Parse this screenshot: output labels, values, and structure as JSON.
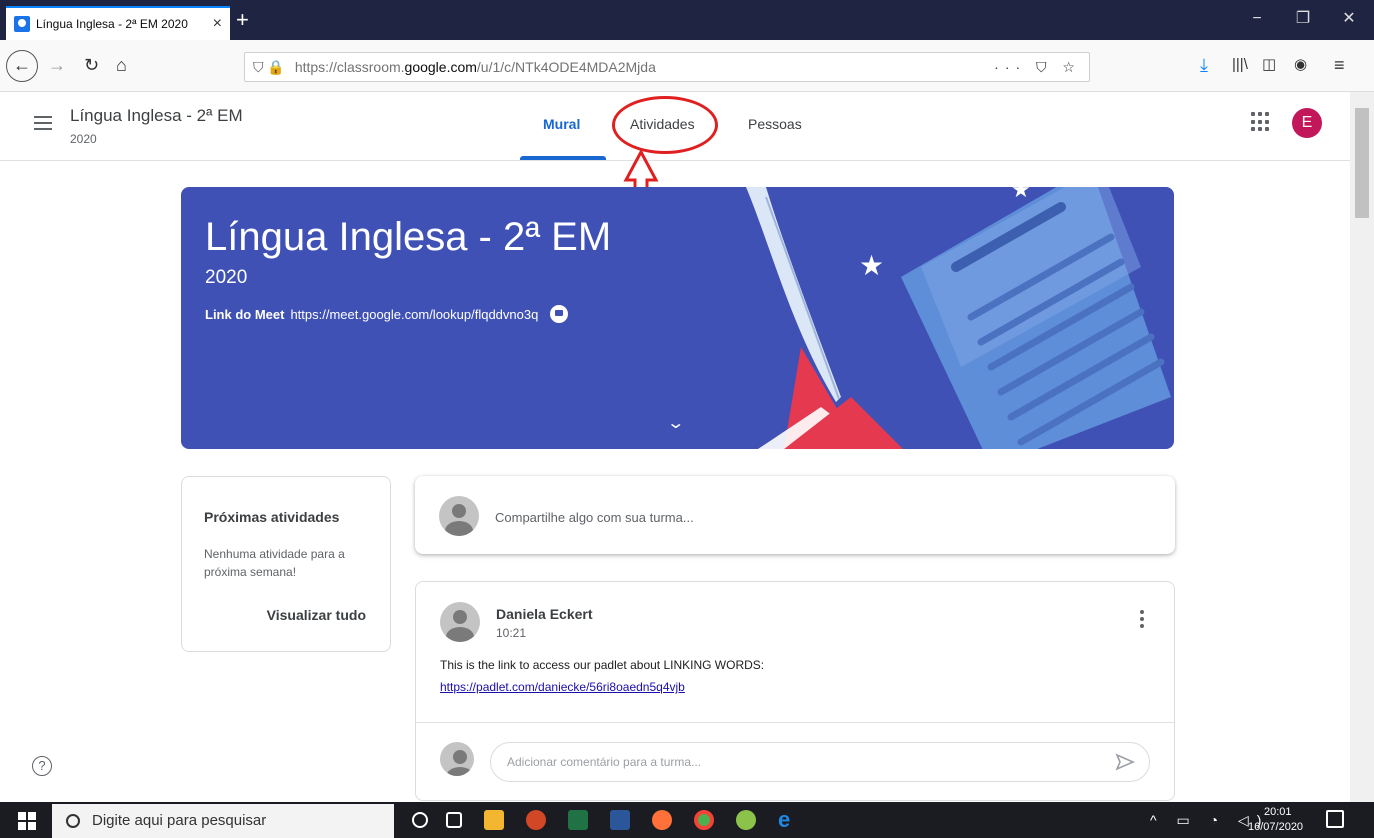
{
  "browser": {
    "tab_title": "Língua Inglesa - 2ª EM 2020",
    "tab_close": "×",
    "new_tab": "+",
    "url_prefix": "https://classroom.",
    "url_domain": "google.com",
    "url_path": "/u/1/c/NTk4ODE4MDA2Mjda",
    "url_actions": "··· ⛉ ☆",
    "win_min": "−",
    "win_restore": "❐",
    "win_close": "✕"
  },
  "header": {
    "class_title": "Língua Inglesa - 2ª EM",
    "class_subtitle": "2020",
    "tabs": [
      {
        "label": "Mural"
      },
      {
        "label": "Atividades"
      },
      {
        "label": "Pessoas"
      }
    ],
    "avatar_letter": "E"
  },
  "banner": {
    "title": "Língua Inglesa - 2ª EM",
    "year": "2020",
    "meet_label": "Link do Meet",
    "meet_url": "https://meet.google.com/lookup/flqddvno3q",
    "colors": {
      "background": "#3f51b5"
    }
  },
  "upcoming": {
    "title": "Próximas atividades",
    "text": "Nenhuma atividade para a próxima semana!",
    "view_all": "Visualizar tudo"
  },
  "share": {
    "placeholder": "Compartilhe algo com sua turma..."
  },
  "post": {
    "author": "Daniela Eckert",
    "time": "10:21",
    "body": "This is the link to access our padlet about LINKING WORDS:",
    "link": "https://padlet.com/daniecke/56ri8oaedn5q4vjb",
    "comment_placeholder": "Adicionar comentário para a turma..."
  },
  "taskbar": {
    "search_placeholder": "Digite aqui para pesquisar",
    "time": "20:01",
    "date": "16/07/2020"
  },
  "icons": [
    "back-icon",
    "forward-icon",
    "reload-icon",
    "home-icon",
    "lock-icon",
    "menu-icon",
    "apps-icon",
    "meet-icon",
    "chevron-down-icon",
    "more-vert-icon",
    "send-icon",
    "help-icon"
  ]
}
